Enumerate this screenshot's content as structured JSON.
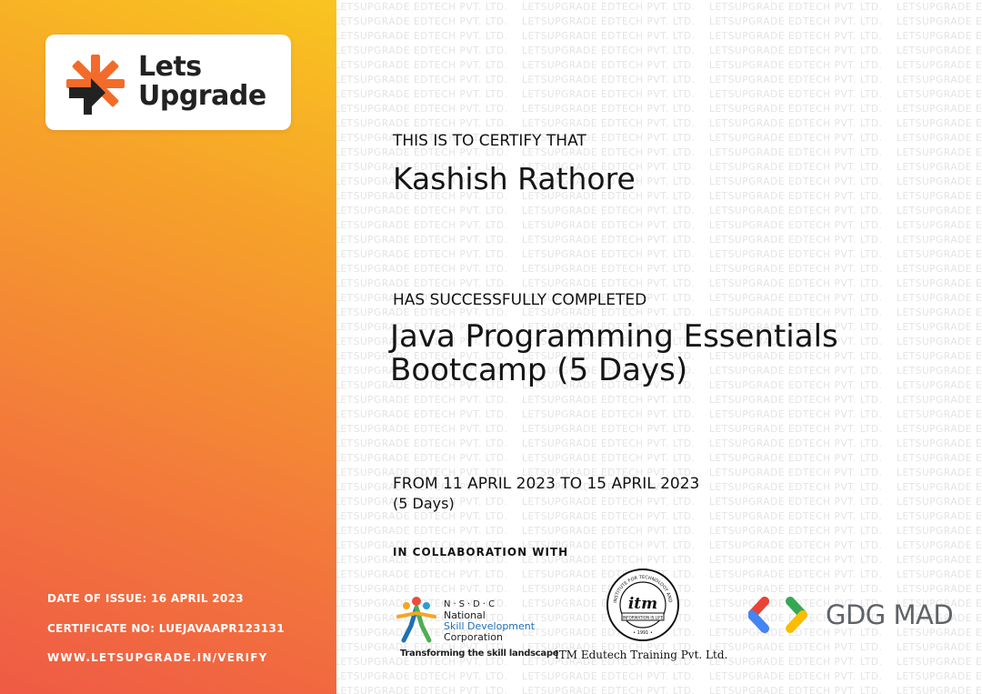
{
  "brand": {
    "logo_line1": "Lets",
    "logo_line2": "Upgrade"
  },
  "certificate": {
    "certify_label": "THIS IS TO CERTIFY THAT",
    "recipient_name": "Kashish Rathore",
    "completed_label": "HAS SUCCESSFULLY COMPLETED",
    "course_title": "Java Programming Essentials Bootcamp (5 Days)",
    "date_range": "FROM 11 APRIL 2023 TO 15 APRIL 2023",
    "duration": "(5 Days)",
    "collab_label": "IN COLLABORATION WITH"
  },
  "issue_info": {
    "date_of_issue": "DATE OF ISSUE: 16 APRIL 2023",
    "certificate_no": "CERTIFICATE NO: LUEJAVAAPR123131",
    "verify_url": "WWW.LETSUPGRADE.IN/VERIFY"
  },
  "watermark_text": "LETSUPGRADE EDTECH PVT. LTD.",
  "partners": {
    "nsdc": {
      "abbr": "N·S·D·C",
      "name_line1": "National",
      "name_line2": "Skill Development",
      "name_line3": "Corporation",
      "tagline": "Transforming the skill landscape"
    },
    "itm": {
      "seal_text": "itm",
      "seal_arc_text": "INSTITUTE FOR TECHNOLOGY AND MANAGEMENT",
      "seal_ribbon": "INFORMATION IS LIFE",
      "seal_year": "1991",
      "name": "ITM Edutech Training Pvt. Ltd."
    },
    "gdg": {
      "name": "GDG MAD"
    }
  },
  "colors": {
    "gradient_top": "#f9c51f",
    "gradient_bottom": "#ef5a45",
    "logo_orange": "#f26b2a",
    "text_dark": "#111111",
    "gdg_red": "#ea4335",
    "gdg_blue": "#4285f4",
    "gdg_green": "#34a853",
    "gdg_yellow": "#fbbc04"
  }
}
